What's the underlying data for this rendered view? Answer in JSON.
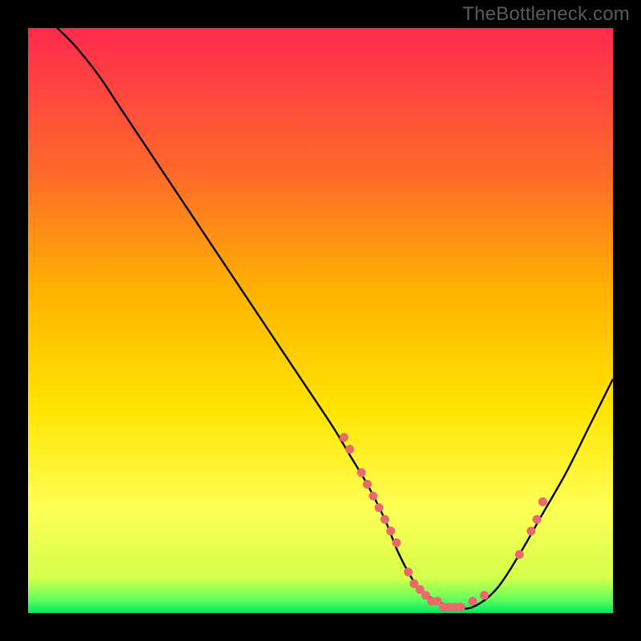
{
  "watermark": "TheBottleneck.com",
  "colors": {
    "frame": "#000000",
    "curve_stroke": "#000000",
    "marker_fill": "#e96a6d",
    "watermark_text": "#5b5b5b",
    "gradient_top": "#ff2a4e",
    "gradient_mid1": "#ff8a00",
    "gradient_mid2": "#ffd400",
    "gradient_mid3": "#ffff3a",
    "gradient_bottom": "#00e863"
  },
  "chart_data": {
    "type": "line",
    "title": "",
    "xlabel": "",
    "ylabel": "",
    "xlim": [
      0,
      100
    ],
    "ylim": [
      0,
      100
    ],
    "grid": false,
    "legend": false,
    "series": [
      {
        "name": "curve",
        "x": [
          5,
          8,
          12,
          16,
          22,
          28,
          34,
          40,
          46,
          52,
          55,
          58,
          61,
          63,
          65,
          67,
          70,
          73,
          76,
          80,
          84,
          88,
          92,
          96,
          100
        ],
        "y": [
          100,
          97,
          92,
          86,
          77,
          68,
          59,
          50,
          41,
          32,
          27,
          22,
          16,
          11,
          7,
          4,
          2,
          1,
          1,
          4,
          10,
          17,
          24,
          32,
          40
        ]
      }
    ],
    "markers": {
      "x": [
        54,
        55,
        57,
        58,
        59,
        60,
        61,
        62,
        63,
        65,
        66,
        67,
        68,
        69,
        70,
        71,
        72,
        73,
        74,
        76,
        78,
        84,
        86,
        87,
        88
      ],
      "y": [
        30,
        28,
        24,
        22,
        20,
        18,
        16,
        14,
        12,
        7,
        5,
        4,
        3,
        2,
        2,
        1,
        1,
        1,
        1,
        2,
        3,
        10,
        14,
        16,
        19
      ]
    },
    "gradient_stops": [
      {
        "offset": 0.0,
        "color": "#ff2a4e"
      },
      {
        "offset": 0.25,
        "color": "#ff6a2a"
      },
      {
        "offset": 0.45,
        "color": "#ffb300"
      },
      {
        "offset": 0.65,
        "color": "#ffe400"
      },
      {
        "offset": 0.82,
        "color": "#ffff55"
      },
      {
        "offset": 0.94,
        "color": "#d4ff4a"
      },
      {
        "offset": 0.975,
        "color": "#6bff5a"
      },
      {
        "offset": 1.0,
        "color": "#00e863"
      }
    ]
  }
}
